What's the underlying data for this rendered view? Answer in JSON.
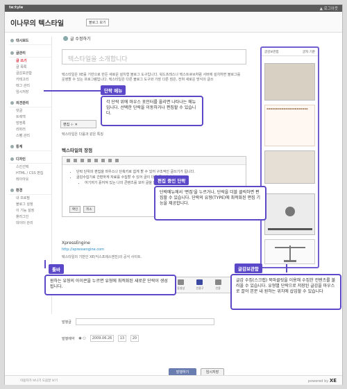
{
  "topbar": {
    "logo": "te:tyle",
    "logout": "▲ 로그아웃"
  },
  "header": {
    "blog_name": "이나무의 텍스타일",
    "blog_view_button": "블로그 보기"
  },
  "sidebar": {
    "groups": [
      {
        "label": "대시보드",
        "items": []
      },
      {
        "label": "글관리",
        "items": [
          "글 쓰기",
          "글 목록",
          "글감보관함",
          "카테고리",
          "태그 관리",
          "임시저장"
        ]
      },
      {
        "label": "의견관리",
        "items": [
          "댓글",
          "트랙백",
          "방명록",
          "리퍼러",
          "스팸 관리"
        ]
      },
      {
        "label": "통계",
        "items": []
      },
      {
        "label": "디자인",
        "items": [
          "스킨선택",
          "HTML / CSS 편집",
          "레이아웃"
        ]
      },
      {
        "label": "환경",
        "items": [
          "내 프로필",
          "블로그 설정",
          "이 기능 설정",
          "플러그인",
          "데이터 관리"
        ]
      }
    ]
  },
  "main": {
    "page_title": "글 수정하기",
    "title_placeholder": "텍스타일을 소개합니다",
    "intro_text": "텍스타일은 XE를 기반으로 만든 새로운 설치형 블로그 도구입니다. 워드프레스나 텍스트큐브처럼 서버에 설치하면 블로그를 운영할 수 있는 프로그램입니다. 텍스타일은 다른 블로그 도구와 가장 다른 점은, 전혀 새로운 방식의 글쓰",
    "edit_menu_label": "편집",
    "para2": "텍스타일은 다음과 같은 특징",
    "section_title": "텍스타일의 장점",
    "editor_items": [
      "단락 단위의 편집을 마우스나 단축키로 쉽게 할 수 있어 구조적인 글쓰기가 됩니다.",
      "글감수집기로 간편하게 자료를 수집할 수 있어 글이 더욱 풍성해진다.",
      "어기저기 흩어져 있는 나의 콘텐츠를 모아 글을 쓸 수 있다."
    ],
    "editor_ok": "확인",
    "editor_cancel": "취소",
    "xe_title": "XpressEngine",
    "xe_link": "http://xpressengine.com",
    "xe_desc": "텍스타일의 기반인 XE(익스프레스엔진)의 공식 사이트.",
    "toolbar": [
      "그룹형",
      "텍스트",
      "링크",
      "파일",
      "이미지",
      "사진",
      "동영상",
      "인용구",
      "인용",
      "구분선"
    ],
    "field1_label": "발행글",
    "field2_label": "발행예약",
    "date_value": "2009.06.26",
    "hour_value": "13",
    "minute_value": "20",
    "submit": "발행하기",
    "cancel": "임시저장"
  },
  "right_panel": {
    "header": "글감보관함",
    "tab": "글자 기준"
  },
  "callouts": {
    "paragraph_menu_title": "단락 메뉴",
    "paragraph_menu_text": "각 단락 위에 마우스 포인터를 올리면 나타나는 메뉴입니다. 선택한 단락을 이동하거나 편집할 수 있습니다.",
    "editing_title": "편집 중인 단락",
    "editing_text": "단락메뉴에서 '편집'을 누르거나, 단락을 더블 클릭하면 편집할 수 있습니다. 단락의 유형(TYPE)에 최적화된 편집 기능을 제공합니다.",
    "toolbar_title": "툴바",
    "toolbar_text": "원하는 유형의 아이콘을 누르면 유형에 최적화된 새로운 단락이 생성됩니다.",
    "collect_title": "글감보관함",
    "collect_text": "글감 수집(스크랩) 북마클릿을 이용해 수집한 컨텐츠를 불러올 수 있습니다. 유형별 단락으로 저장된 글감을 마우스로 끌어 본문 내 원하는 위치에 삽입할 수 있습니다"
  },
  "footer": {
    "links": "이용자가 보니기   도움말 보기",
    "powered": "powered by",
    "brand": "XE"
  }
}
